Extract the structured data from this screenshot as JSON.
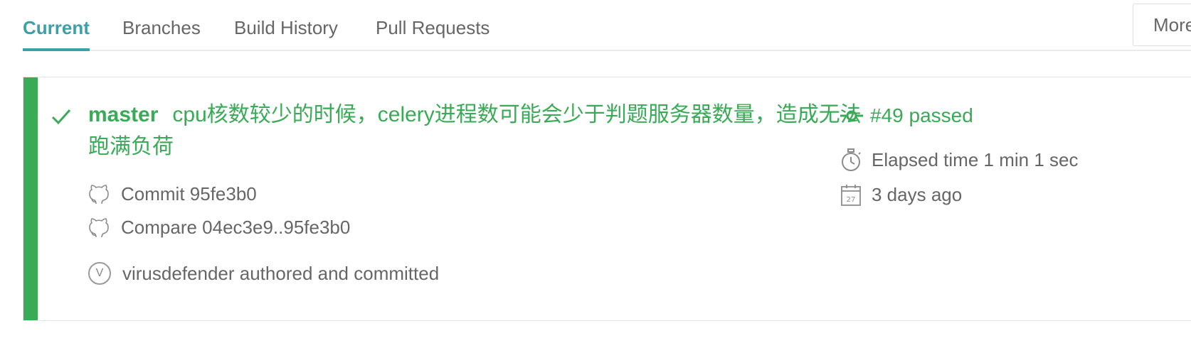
{
  "tabs": [
    {
      "label": "Current",
      "active": true
    },
    {
      "label": "Branches",
      "active": false
    },
    {
      "label": "Build History",
      "active": false
    },
    {
      "label": "Pull Requests",
      "active": false
    }
  ],
  "more_label": "More",
  "build": {
    "status": "passed",
    "status_color": "#39aa56",
    "branch": "master",
    "message": "cpu核数较少的时候，celery进程数可能会少于判题服务器数量，造成无法跑满负荷",
    "commit_label": "Commit 95fe3b0",
    "compare_label": "Compare 04ec3e9..95fe3b0",
    "author_initial": "V",
    "author_text": "virusdefender authored and committed",
    "build_number_label": "#49 passed",
    "elapsed_label": "Elapsed time 1 min 1 sec",
    "finished_label": "3 days ago",
    "calendar_day": "27"
  },
  "icons": {
    "check": "check-icon",
    "github": "github-icon",
    "commit": "commit-icon",
    "stopwatch": "stopwatch-icon",
    "calendar": "calendar-icon"
  },
  "colors": {
    "accent": "#3ba0a8",
    "passed": "#39aa56"
  }
}
